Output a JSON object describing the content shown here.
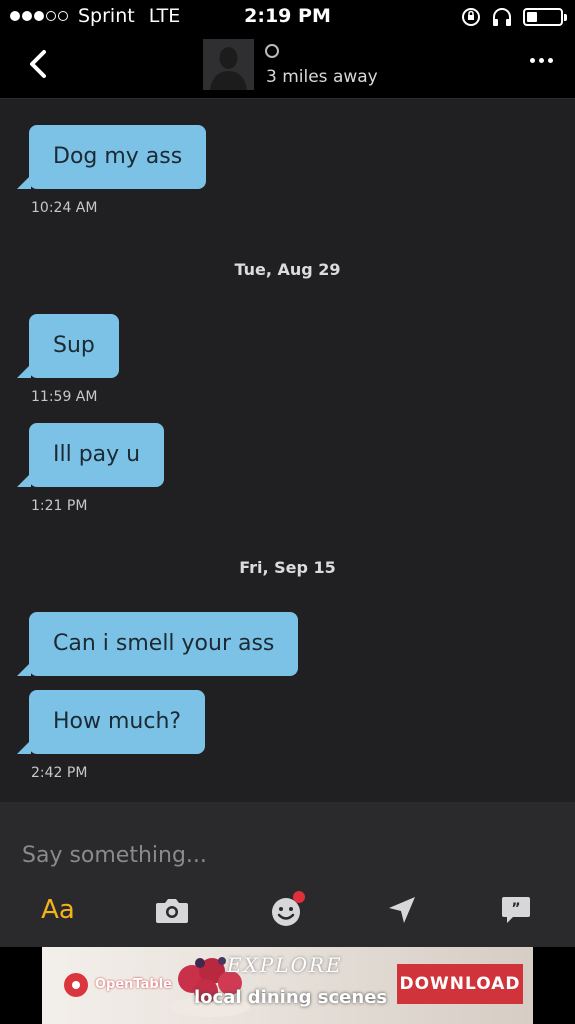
{
  "status_bar": {
    "carrier": "Sprint",
    "network": "LTE",
    "time": "2:19 PM",
    "signal_bars_filled": 3,
    "signal_bars_total": 5,
    "battery_level": 0.3
  },
  "header": {
    "back_icon": "chevron-left-icon",
    "avatar_icon": "person-placeholder-icon",
    "online_status_icon": "circle-outline-icon",
    "distance": "3 miles away",
    "more_icon": "ellipsis-icon"
  },
  "messages": [
    {
      "type": "message",
      "text": "Dog my ass",
      "time": "10:24 AM"
    },
    {
      "type": "date",
      "text": "Tue, Aug 29"
    },
    {
      "type": "message",
      "text": "Sup",
      "time": "11:59 AM"
    },
    {
      "type": "message",
      "text": "Ill pay u",
      "time": "1:21 PM"
    },
    {
      "type": "date",
      "text": "Fri, Sep 15"
    },
    {
      "type": "message",
      "text": "Can i smell your ass",
      "time": ""
    },
    {
      "type": "message",
      "text": "How much?",
      "time": "2:42 PM"
    }
  ],
  "composer": {
    "placeholder": "Say something...",
    "text_format_label": "Aa",
    "icons": [
      "camera-icon",
      "sticker-icon",
      "location-arrow-icon",
      "saved-phrases-icon"
    ],
    "notification_dot_color": "#e0303c"
  },
  "ad": {
    "brand": "OpenTable",
    "headline": "EXPLORE",
    "tagline": "local dining scenes",
    "cta": "DOWNLOAD"
  },
  "colors": {
    "bubble": "#7cc2e6",
    "background": "#202022",
    "accent": "#f5b31a"
  }
}
